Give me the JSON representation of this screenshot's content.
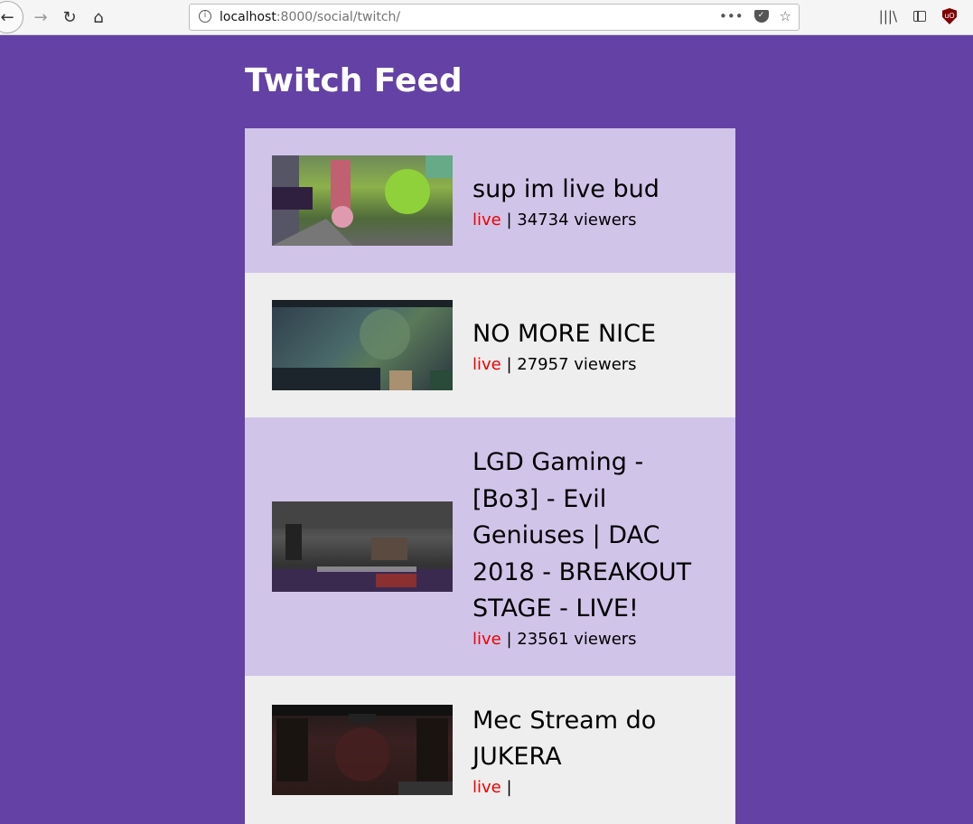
{
  "browser": {
    "url_host": "localhost",
    "url_rest": ":8000/social/twitch/"
  },
  "page": {
    "title": "Twitch Feed"
  },
  "streams": [
    {
      "title": "sup im live bud",
      "status": "live",
      "viewers_text": "34734 viewers"
    },
    {
      "title": "NO MORE NICE",
      "status": "live",
      "viewers_text": "27957 viewers"
    },
    {
      "title": "LGD Gaming - [Bo3] - Evil Geniuses | DAC 2018 - BREAKOUT STAGE - LIVE!",
      "status": "live",
      "viewers_text": "23561 viewers"
    },
    {
      "title": "Mec Stream do JUKERA",
      "status": "live",
      "viewers_text": ""
    }
  ],
  "colors": {
    "background": "#6441a5",
    "card_odd": "#d1c4e9",
    "card_even": "#eeeeee",
    "live": "#ee0000"
  }
}
